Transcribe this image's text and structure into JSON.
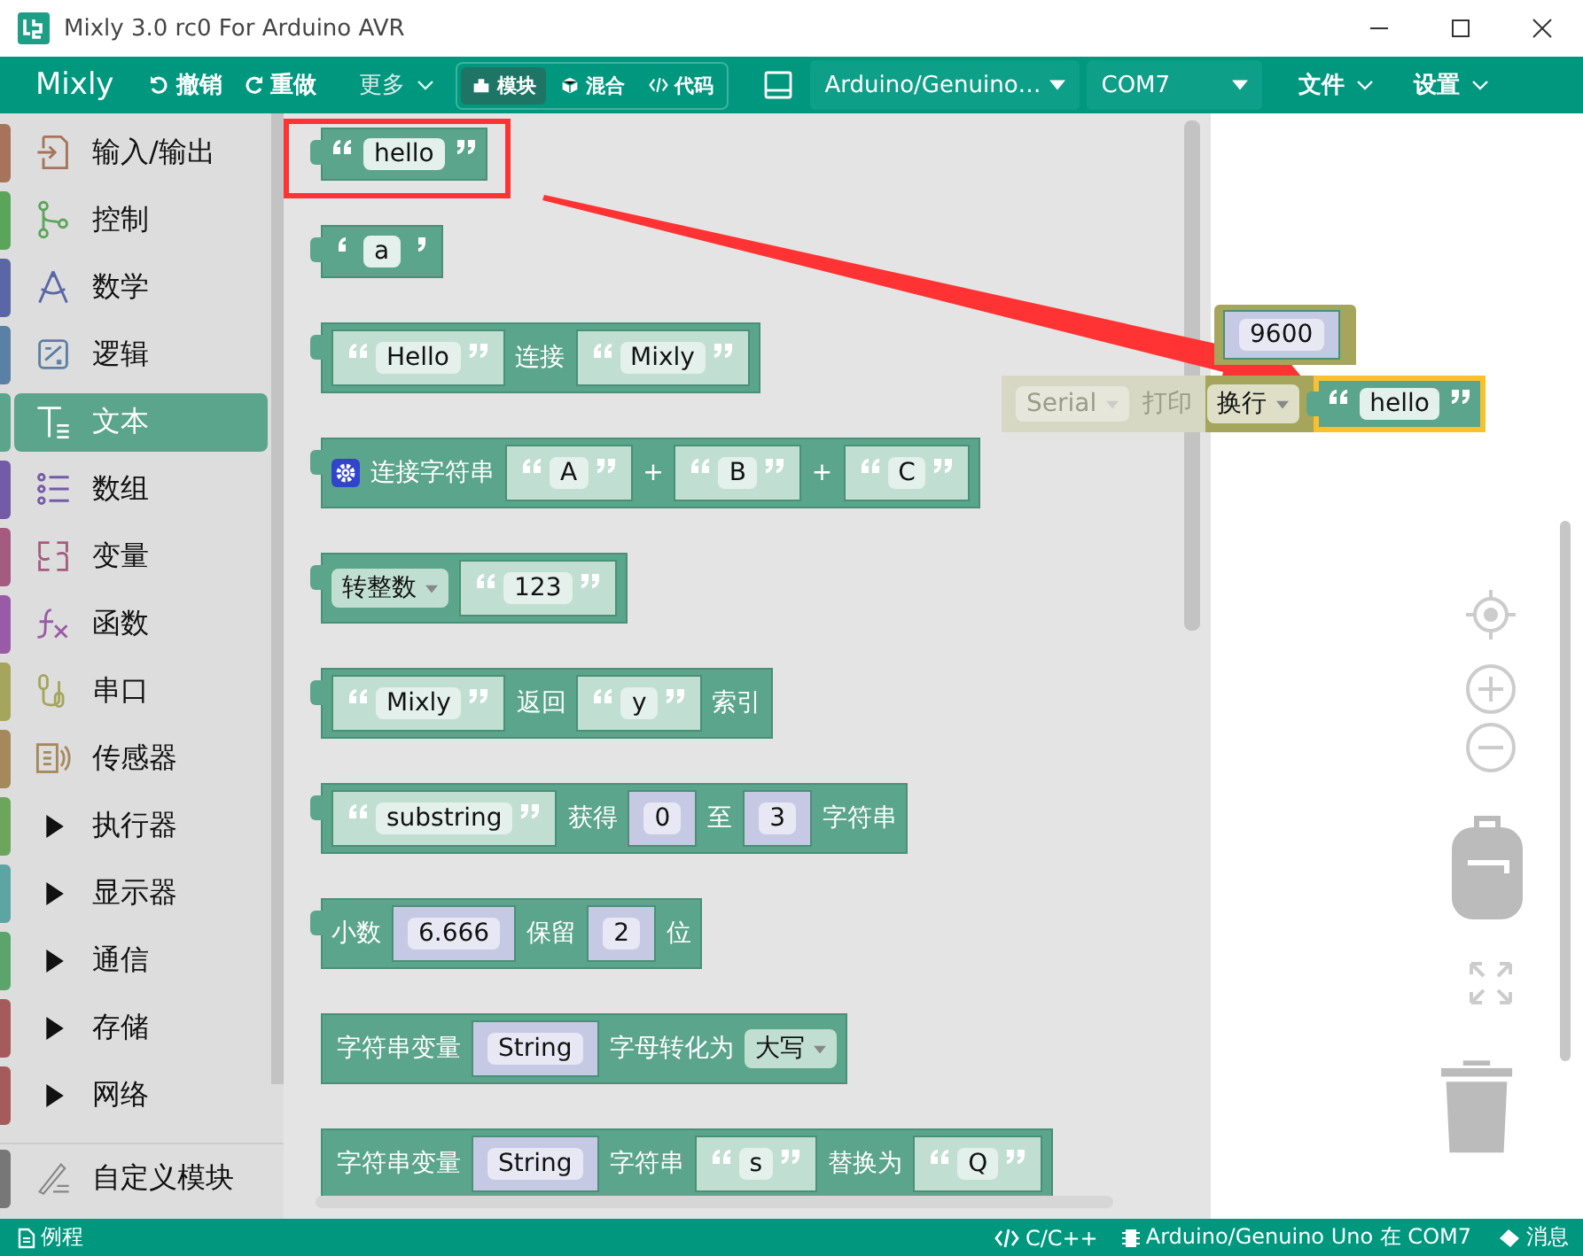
{
  "window": {
    "title": "Mixly 3.0 rc0 For Arduino AVR"
  },
  "toolbar": {
    "brand": "Mixly",
    "undo": "撤销",
    "redo": "重做",
    "more": "更多",
    "modes": [
      {
        "label": "模块",
        "selected": true
      },
      {
        "label": "混合",
        "selected": false
      },
      {
        "label": "代码",
        "selected": false
      }
    ],
    "board": "Arduino/Genuino…",
    "port": "COM7",
    "file_menu": "文件",
    "settings_menu": "设置"
  },
  "sidebar": {
    "items": [
      {
        "label": "输入/输出",
        "kind": "category",
        "color": "#a5745b",
        "selected": false
      },
      {
        "label": "控制",
        "kind": "category",
        "color": "#5ba55b",
        "selected": false
      },
      {
        "label": "数学",
        "kind": "category",
        "color": "#5b67a5",
        "selected": false
      },
      {
        "label": "逻辑",
        "kind": "category",
        "color": "#5b80a5",
        "selected": false
      },
      {
        "label": "文本",
        "kind": "category",
        "color": "#5ba58c",
        "selected": true
      },
      {
        "label": "数组",
        "kind": "category",
        "color": "#745ba5",
        "selected": false
      },
      {
        "label": "变量",
        "kind": "category",
        "color": "#a55b80",
        "selected": false
      },
      {
        "label": "函数",
        "kind": "category",
        "color": "#995ba5",
        "selected": false
      },
      {
        "label": "串口",
        "kind": "category",
        "color": "#a5a55b",
        "selected": false
      },
      {
        "label": "传感器",
        "kind": "category",
        "color": "#a5885b",
        "selected": false
      },
      {
        "label": "执行器",
        "kind": "folder",
        "color": "#6ca55b",
        "selected": false,
        "expanded": false
      },
      {
        "label": "显示器",
        "kind": "folder",
        "color": "#5ba5a5",
        "selected": false,
        "expanded": false
      },
      {
        "label": "通信",
        "kind": "folder",
        "color": "#5ba56c",
        "selected": false,
        "expanded": false
      },
      {
        "label": "存储",
        "kind": "folder",
        "color": "#a55b5b",
        "selected": false,
        "expanded": false
      },
      {
        "label": "网络",
        "kind": "folder",
        "color": "#a55b5b",
        "selected": false,
        "expanded": false
      },
      {
        "label": "自定义模块",
        "kind": "custom",
        "color": "#777777",
        "selected": false
      }
    ]
  },
  "flyout": {
    "blocks": [
      {
        "kind": "value",
        "highlighted": true,
        "parts": [
          {
            "kind": "quote",
            "text": "hello"
          }
        ]
      },
      {
        "kind": "value",
        "highlighted": false,
        "parts": [
          {
            "kind": "char",
            "text": "a"
          }
        ]
      },
      {
        "kind": "value",
        "highlighted": false,
        "parts": [
          {
            "kind": "string",
            "text": "Hello"
          },
          {
            "kind": "label",
            "text": "连接"
          },
          {
            "kind": "string",
            "text": "Mixly"
          }
        ]
      },
      {
        "kind": "value",
        "highlighted": false,
        "parts": [
          {
            "kind": "gear"
          },
          {
            "kind": "label",
            "text": "连接字符串"
          },
          {
            "kind": "string",
            "text": "A"
          },
          {
            "kind": "label",
            "text": "+"
          },
          {
            "kind": "string",
            "text": "B"
          },
          {
            "kind": "label",
            "text": "+"
          },
          {
            "kind": "string",
            "text": "C"
          }
        ]
      },
      {
        "kind": "value",
        "highlighted": false,
        "parts": [
          {
            "kind": "dropdown",
            "text": "转整数"
          },
          {
            "kind": "string",
            "text": "123"
          }
        ]
      },
      {
        "kind": "value",
        "highlighted": false,
        "parts": [
          {
            "kind": "string",
            "text": "Mixly"
          },
          {
            "kind": "label",
            "text": "返回"
          },
          {
            "kind": "string",
            "text": "y"
          },
          {
            "kind": "label",
            "text": "索引"
          }
        ]
      },
      {
        "kind": "value",
        "highlighted": false,
        "parts": [
          {
            "kind": "string",
            "text": "substring"
          },
          {
            "kind": "label",
            "text": "获得"
          },
          {
            "kind": "number",
            "text": "0"
          },
          {
            "kind": "label",
            "text": "至"
          },
          {
            "kind": "number",
            "text": "3"
          },
          {
            "kind": "label",
            "text": "字符串"
          }
        ]
      },
      {
        "kind": "value",
        "highlighted": false,
        "parts": [
          {
            "kind": "label",
            "text": "小数"
          },
          {
            "kind": "number",
            "text": "6.666"
          },
          {
            "kind": "label",
            "text": "保留"
          },
          {
            "kind": "number",
            "text": "2"
          },
          {
            "kind": "label",
            "text": "位"
          }
        ]
      },
      {
        "kind": "statement",
        "highlighted": false,
        "parts": [
          {
            "kind": "label",
            "text": "字符串变量"
          },
          {
            "kind": "number",
            "text": "String"
          },
          {
            "kind": "label",
            "text": "字母转化为"
          },
          {
            "kind": "dropdown",
            "text": "大写"
          }
        ]
      },
      {
        "kind": "statement",
        "highlighted": false,
        "parts": [
          {
            "kind": "label",
            "text": "字符串变量"
          },
          {
            "kind": "number",
            "text": "String"
          },
          {
            "kind": "label",
            "text": "字符串"
          },
          {
            "kind": "string",
            "text": "s"
          },
          {
            "kind": "label",
            "text": "替换为"
          },
          {
            "kind": "string",
            "text": "Q"
          }
        ]
      }
    ]
  },
  "workspace": {
    "baud": "9600",
    "serial": "Serial",
    "print": "打印",
    "mode": "换行",
    "attached": "hello"
  },
  "status_bar": {
    "examples": "例程",
    "language": "C/C++",
    "board": "Arduino/Genuino Uno 在 COM7",
    "messages": "消息"
  }
}
